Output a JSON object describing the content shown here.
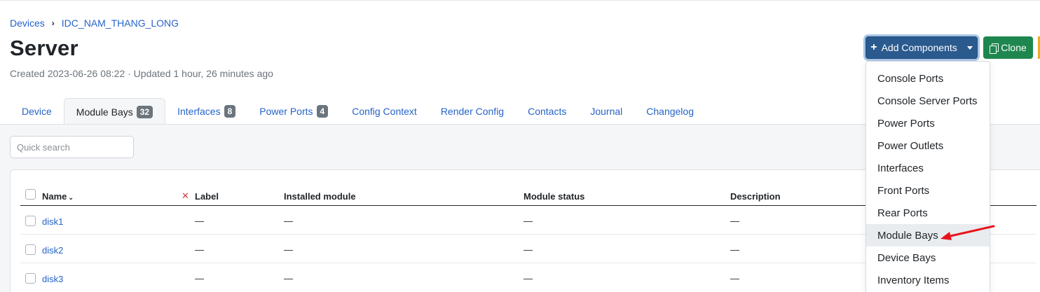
{
  "breadcrumb": {
    "root": "Devices",
    "parent": "IDC_NAM_THANG_LONG"
  },
  "page": {
    "title": "Server",
    "meta": "Created 2023-06-26 08:22 · Updated 1 hour, 26 minutes ago"
  },
  "actions": {
    "add_components": "Add Components",
    "clone": "Clone"
  },
  "tabs": [
    {
      "label": "Device"
    },
    {
      "label": "Module Bays",
      "badge": "32"
    },
    {
      "label": "Interfaces",
      "badge": "8"
    },
    {
      "label": "Power Ports",
      "badge": "4"
    },
    {
      "label": "Config Context"
    },
    {
      "label": "Render Config"
    },
    {
      "label": "Contacts"
    },
    {
      "label": "Journal"
    },
    {
      "label": "Changelog"
    }
  ],
  "search": {
    "placeholder": "Quick search"
  },
  "table": {
    "columns": {
      "name": "Name",
      "label": "Label",
      "installed_module": "Installed module",
      "module_status": "Module status",
      "description": "Description"
    },
    "rows": [
      {
        "name": "disk1",
        "label": "—",
        "installed_module": "—",
        "module_status": "—",
        "description": "—"
      },
      {
        "name": "disk2",
        "label": "—",
        "installed_module": "—",
        "module_status": "—",
        "description": "—"
      },
      {
        "name": "disk3",
        "label": "—",
        "installed_module": "—",
        "module_status": "—",
        "description": "—"
      }
    ]
  },
  "dropdown": {
    "items": [
      "Console Ports",
      "Console Server Ports",
      "Power Ports",
      "Power Outlets",
      "Interfaces",
      "Front Ports",
      "Rear Ports",
      "Module Bays",
      "Device Bays",
      "Inventory Items"
    ],
    "highlighted": "Module Bays"
  },
  "colors": {
    "primary": "#2a5a8e",
    "success": "#1e874f",
    "link": "#2563c9",
    "annotation_arrow": "#e8141b"
  },
  "icons": {
    "add": "plus-icon",
    "clone": "copy-icon",
    "caret": "caret-down-icon",
    "clear": "x-icon",
    "sort": "chevron-down-icon"
  }
}
